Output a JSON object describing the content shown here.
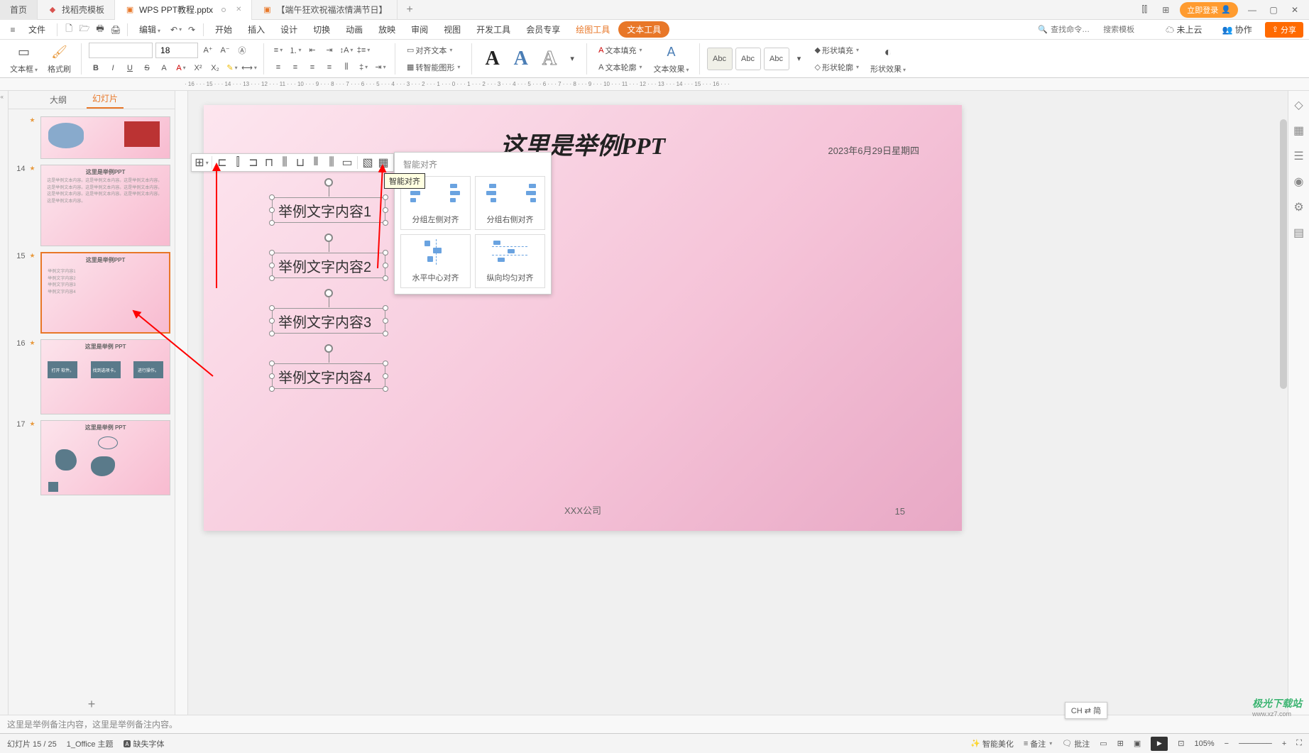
{
  "titlebar": {
    "home": "首页",
    "tabs": [
      {
        "label": "找稻壳模板",
        "icon": "red"
      },
      {
        "label": "WPS PPT教程.pptx",
        "icon": "orange",
        "active": true
      },
      {
        "label": "【端午狂欢祝福浓情满节日】",
        "icon": "orange"
      }
    ],
    "login": "立即登录"
  },
  "menubar": {
    "file": "文件",
    "edit": "编辑",
    "items": [
      "开始",
      "插入",
      "设计",
      "切换",
      "动画",
      "放映",
      "审阅",
      "视图",
      "开发工具",
      "会员专享"
    ],
    "drawing": "绘图工具",
    "texttool": "文本工具",
    "search_cmd": "查找命令…",
    "search_tpl": "搜索模板",
    "not_cloud": "未上云",
    "coop": "协作",
    "share": "分享"
  },
  "ribbon": {
    "textbox": "文本框",
    "format_painter": "格式刷",
    "font_size": "18",
    "align_text": "对齐文本",
    "to_smart": "转智能图形",
    "text_fill": "文本填充",
    "text_outline": "文本轮廓",
    "text_effect": "文本效果",
    "abc": "Abc",
    "shape_fill": "形状填充",
    "shape_outline": "形状轮廓",
    "shape_effect": "形状效果"
  },
  "ruler": "· 16 · · · 15 · · · 14 · · · 13 · · · 12 · · · 11 · · · 10 · · · 9 · · · 8 · · · 7 · · · 6 · · · 5 · · · 4 · · · 3 · · · 2 · · · 1 · · · 0 · · · 1 · · · 2 · · · 3 · · · 4 · · · 5 · · · 6 · · · 7 · · · 8 · · · 9 · · · 10 · · · 11 · · · 12 · · · 13 · · · 14 · · · 15 · · · 16 · · ·",
  "slidepanel": {
    "outline": "大纲",
    "slides": "幻灯片",
    "items": [
      {
        "num": "",
        "title": ""
      },
      {
        "num": "14",
        "title": "这里是举例PPT",
        "body": "这是举例文本内容。这是举例文本内容。这是举例文本内容。这是举例文本内容。这是举例文本内容。这是举例文本内容。这是举例文本内容。这是举例文本内容。这是举例文本内容。这是举例文本内容。"
      },
      {
        "num": "15",
        "title": "这里是举例PPT",
        "body": "举例文字内容1\n举例文字内容2\n举例文字内容3\n举例文字内容4"
      },
      {
        "num": "16",
        "title": "这里是举例 PPT",
        "boxes": [
          "打开\n软件。",
          "找到选项卡。",
          "进行操作。"
        ]
      },
      {
        "num": "17",
        "title": "这里是举例 PPT"
      }
    ]
  },
  "canvas": {
    "title": "这里是举例PPT",
    "date": "2023年6月29日星期四",
    "company": "XXX公司",
    "pagenum": "15",
    "textboxes": [
      "举例文字内容1",
      "举例文字内容2",
      "举例文字内容3",
      "举例文字内容4"
    ]
  },
  "tooltip": "智能对齐",
  "smart_popup": {
    "header": "智能对齐",
    "items": [
      "分组左侧对齐",
      "分组右侧对齐",
      "水平中心对齐",
      "纵向均匀对齐"
    ]
  },
  "notes": "这里是举例备注内容，这里是举例备注内容。",
  "statusbar": {
    "slide_pos": "幻灯片 15 / 25",
    "theme": "1_Office 主题",
    "missing_font": "缺失字体",
    "smart_beautify": "智能美化",
    "notes_btn": "备注",
    "comments": "批注",
    "ime": "CH ⇄ 简",
    "zoom": "105%"
  },
  "watermark": {
    "main": "极光下载站",
    "sub": "www.xz7.com"
  }
}
